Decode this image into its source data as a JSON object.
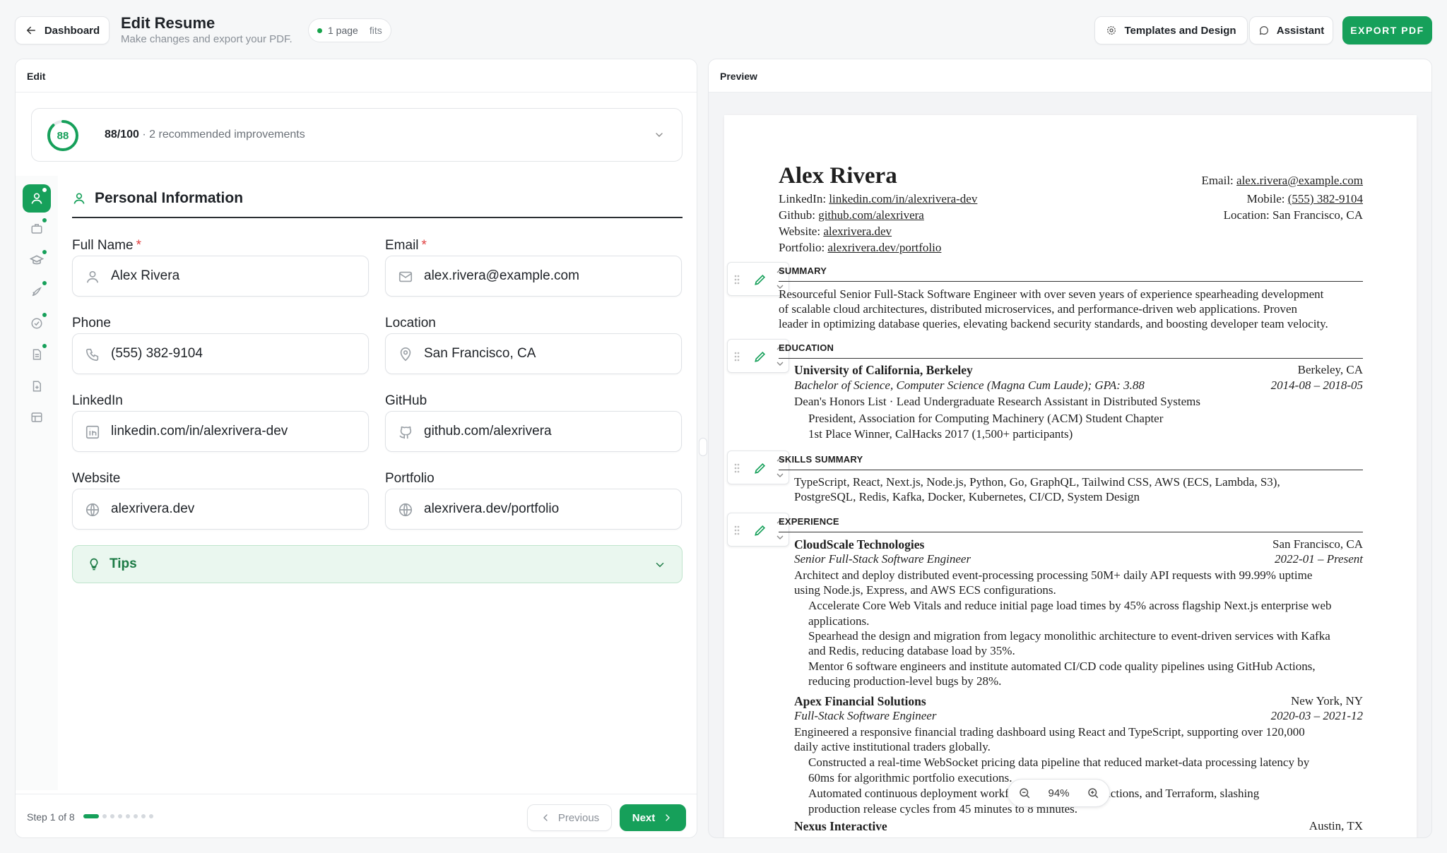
{
  "header": {
    "back_label": "Dashboard",
    "title": "Edit Resume",
    "subtitle": "Make changes and export your PDF.",
    "page_pill": "1 page",
    "fits_label": "fits",
    "templates_label": "Templates and Design",
    "assistant_label": "Assistant",
    "export_label": "EXPORT PDF"
  },
  "edit": {
    "panel_title": "Edit",
    "score": {
      "value": "88",
      "text": "88/100",
      "detail": "· 2 recommended improvements"
    },
    "section_title": "Personal Information",
    "fields": {
      "full_name_label": "Full Name",
      "full_name_value": "Alex Rivera",
      "email_label": "Email",
      "email_value": "alex.rivera@example.com",
      "phone_label": "Phone",
      "phone_value": "(555) 382-9104",
      "location_label": "Location",
      "location_value": "San Francisco, CA",
      "linkedin_label": "LinkedIn",
      "linkedin_value": "linkedin.com/in/alexrivera-dev",
      "github_label": "GitHub",
      "github_value": "github.com/alexrivera",
      "website_label": "Website",
      "website_value": "alexrivera.dev",
      "portfolio_label": "Portfolio",
      "portfolio_value": "alexrivera.dev/portfolio",
      "required_mark": "*"
    },
    "tips_label": "Tips",
    "footer": {
      "step_text": "Step 1 of 8",
      "step_progress": 0.125,
      "previous_label": "Previous",
      "next_label": "Next"
    }
  },
  "preview": {
    "panel_title": "Preview",
    "zoom": "94%",
    "resume": {
      "name": "Alex Rivera",
      "email_prefix": "Email: ",
      "email": "alex.rivera@example.com",
      "mobile_prefix": "Mobile: ",
      "mobile": "(555) 382-9104",
      "location_line": "Location: San Francisco, CA",
      "linkedin_prefix": "LinkedIn: ",
      "linkedin": "linkedin.com/in/alexrivera-dev",
      "github_prefix": "Github: ",
      "github": "github.com/alexrivera",
      "website_prefix": "Website: ",
      "website": "alexrivera.dev",
      "portfolio_prefix": "Portfolio: ",
      "portfolio": "alexrivera.dev/portfolio",
      "summary_heading": "SUMMARY",
      "summary_lines": [
        "Resourceful Senior Full-Stack Software Engineer with over seven years of experience spearheading development",
        "of scalable cloud architectures, distributed microservices, and performance-driven web applications. Proven",
        "leader in optimizing database queries, elevating backend security standards, and boosting developer team velocity."
      ],
      "education_heading": "EDUCATION",
      "edu_school": "University of California, Berkeley",
      "edu_location": "Berkeley, CA",
      "edu_degree": "Bachelor of Science, Computer Science (Magna Cum Laude); GPA: 3.88",
      "edu_dates": "2014-08 – 2018-05",
      "edu_honors": "Dean's Honors List · Lead Undergraduate Research Assistant in Distributed Systems",
      "edu_bullets": [
        "President, Association for Computing Machinery (ACM) Student Chapter",
        "1st Place Winner, CalHacks 2017 (1,500+ participants)"
      ],
      "skills_heading": "SKILLS SUMMARY",
      "skills_lines": [
        "TypeScript, React, Next.js, Node.js, Python, Go, GraphQL, Tailwind CSS, AWS (ECS, Lambda, S3),",
        "PostgreSQL, Redis, Kafka, Docker, Kubernetes, CI/CD, System Design"
      ],
      "experience_heading": "EXPERIENCE",
      "job1_company": "CloudScale Technologies",
      "job1_location": "San Francisco, CA",
      "job1_title": "Senior Full-Stack Software Engineer",
      "job1_dates": "2022-01 – Present",
      "job1_lines": [
        "Architect and deploy distributed event-processing processing 50M+ daily API requests with 99.99% uptime",
        "using Node.js, Express, and AWS ECS configurations."
      ],
      "job1_bullets": [
        "Accelerate Core Web Vitals and reduce initial page load times by 45% across flagship Next.js enterprise web",
        "applications.",
        "Spearhead the design and migration from legacy monolithic architecture to event-driven services with Kafka",
        "and Redis, reducing database load by 35%.",
        "Mentor 6 software engineers and institute automated CI/CD code quality pipelines using GitHub Actions,",
        "reducing production-level bugs by 28%."
      ],
      "job2_company": "Apex Financial Solutions",
      "job2_location": "New York, NY",
      "job2_title": "Full-Stack Software Engineer",
      "job2_dates": "2020-03 – 2021-12",
      "job2_lines": [
        "Engineered a responsive financial trading dashboard using React and TypeScript, supporting over 120,000",
        "daily active institutional traders globally."
      ],
      "job2_bullets": [
        "Constructed a real-time WebSocket pricing data pipeline that reduced market-data processing latency by",
        "60ms for algorithmic portfolio executions.",
        "Automated continuous deployment workflows using GitHub Actions, and Terraform, slashing",
        "production release cycles from 45 minutes to 8 minutes."
      ],
      "job3_company": "Nexus Interactive",
      "job3_location": "Austin, TX"
    }
  }
}
